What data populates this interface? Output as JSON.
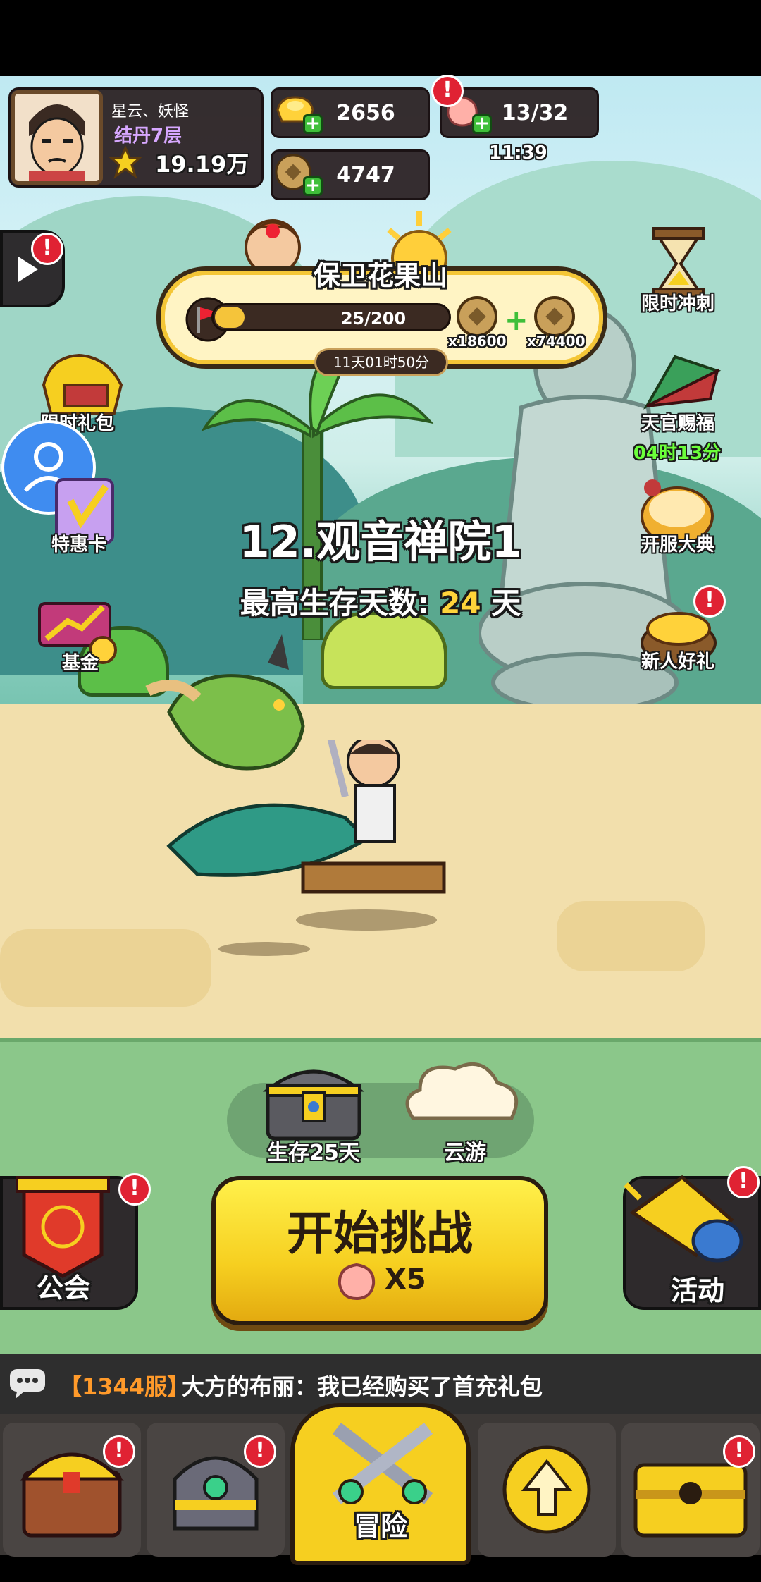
{
  "player": {
    "name": "星云、妖怪",
    "realm": "结丹7层",
    "power": "19.19万"
  },
  "resources": {
    "gold": "2656",
    "coins": "4747",
    "stamina": "13/32",
    "stamina_timer": "11:39"
  },
  "event": {
    "title": "保卫花果山",
    "progress_text": "25/200",
    "progress": 0.125,
    "reward_a": "x18600",
    "reward_b": "x74400",
    "countdown": "11天01时50分"
  },
  "left_menu": {
    "limited_pack": "限时礼包",
    "special_card": "特惠卡",
    "fund": "基金"
  },
  "right_menu": {
    "limited_sprint": "限时冲刺",
    "official_blessing": "天官赐福",
    "blessing_timer": "04时13分",
    "server_ceremony": "开服大典",
    "newbie_gift": "新人好礼"
  },
  "stage": {
    "name": "12.观音禅院1",
    "best_label": "最高生存天数:",
    "best_days": "24",
    "days_unit": "天"
  },
  "rewards": {
    "chest_label": "生存25天",
    "cloud_label": "云游"
  },
  "actions": {
    "guild": "公会",
    "start": "开始挑战",
    "cost": "X5",
    "activity": "活动"
  },
  "chat": {
    "server": "【1344服】",
    "message": "大方的布丽：我已经购买了首充礼包"
  },
  "nav": {
    "adventure": "冒险"
  },
  "colors": {
    "accent_yellow": "#f6cf20",
    "badge_red": "#e02233",
    "timer_green": "#6bff3a",
    "realm_purple": "#d7a7ff",
    "best_days_yellow": "#ffd43a",
    "server_orange": "#ff9a2a"
  },
  "badge_mark": "!"
}
